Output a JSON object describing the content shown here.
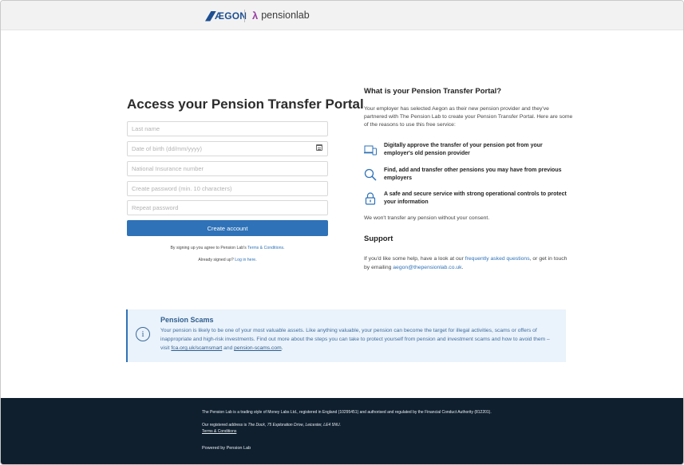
{
  "header": {
    "aegon_logo": "ÆGON",
    "pensionlab_mark": "λ",
    "pensionlab_logo": "pensionlab"
  },
  "form": {
    "title": "Access your Pension Transfer Portal",
    "last_name_placeholder": "Last name",
    "dob_placeholder": "Date of birth (dd/mm/yyyy)",
    "ni_placeholder": "National Insurance number",
    "password_placeholder": "Create password (min. 10 characters)",
    "repeat_password_placeholder": "Repeat password",
    "submit_label": "Create account",
    "terms_prefix": "By signing up you agree to Pension Lab's ",
    "terms_link": "Terms & Conditions",
    "terms_suffix": ".",
    "login_prefix": "Already signed up? ",
    "login_link": "Log in here",
    "login_suffix": "."
  },
  "info": {
    "title": "What is your Pension Transfer Portal?",
    "intro": "Your employer has selected Aegon as their new pension provider and they've partnered with The Pension Lab to create your Pension Transfer Portal. Here are some of the reasons to use this free service:",
    "features": [
      {
        "icon": "devices-icon",
        "text": "Digitally approve the transfer of your pension pot from your employer's old pension provider"
      },
      {
        "icon": "search-icon",
        "text": "Find, add and transfer other pensions you may have from previous employers"
      },
      {
        "icon": "padlock-icon",
        "text": "A safe and secure service with strong operational controls to protect your information"
      }
    ],
    "consent": "We won't transfer any pension without your consent.",
    "support_title": "Support",
    "help_prefix": "If you'd like some help, have a look at our ",
    "faq_link": "frequently asked questions",
    "help_middle": ", or get in touch by emailing ",
    "email_link": "aegon@thepensionlab.co.uk",
    "help_suffix": "."
  },
  "scams": {
    "icon": "info-icon",
    "title": "Pension Scams",
    "text": "Your pension is likely to be one of your most valuable assets. Like anything valuable, your pension can become the target for illegal activities, scams or offers of inappropriate and high-risk investments. Find out more about the steps you can take to protect yourself from pension and investment scams and how to avoid them – visit ",
    "link1": "fca.org.uk/scamsmart",
    "and": " and ",
    "link2": "pension-scams.com",
    "end": "."
  },
  "footer": {
    "legal": "The Pension Lab is a trading style of Money Labs Ltd., registered in England (10295451) and authorised and regulated by the Financial Conduct Authority (812201).",
    "address_prefix": "Our registered address is ",
    "address": "The Dock, 75 Exploration Drive, Leicester, LE4 5NU.",
    "terms_link": "Terms & Conditions",
    "powered_by": "Powered by Pension Lab"
  },
  "colors": {
    "primary_button": "#2f72b7",
    "footer_bg": "#0f1f2e",
    "scam_bg": "#eaf2fb",
    "pensionlab_accent": "#9b3fa5"
  }
}
